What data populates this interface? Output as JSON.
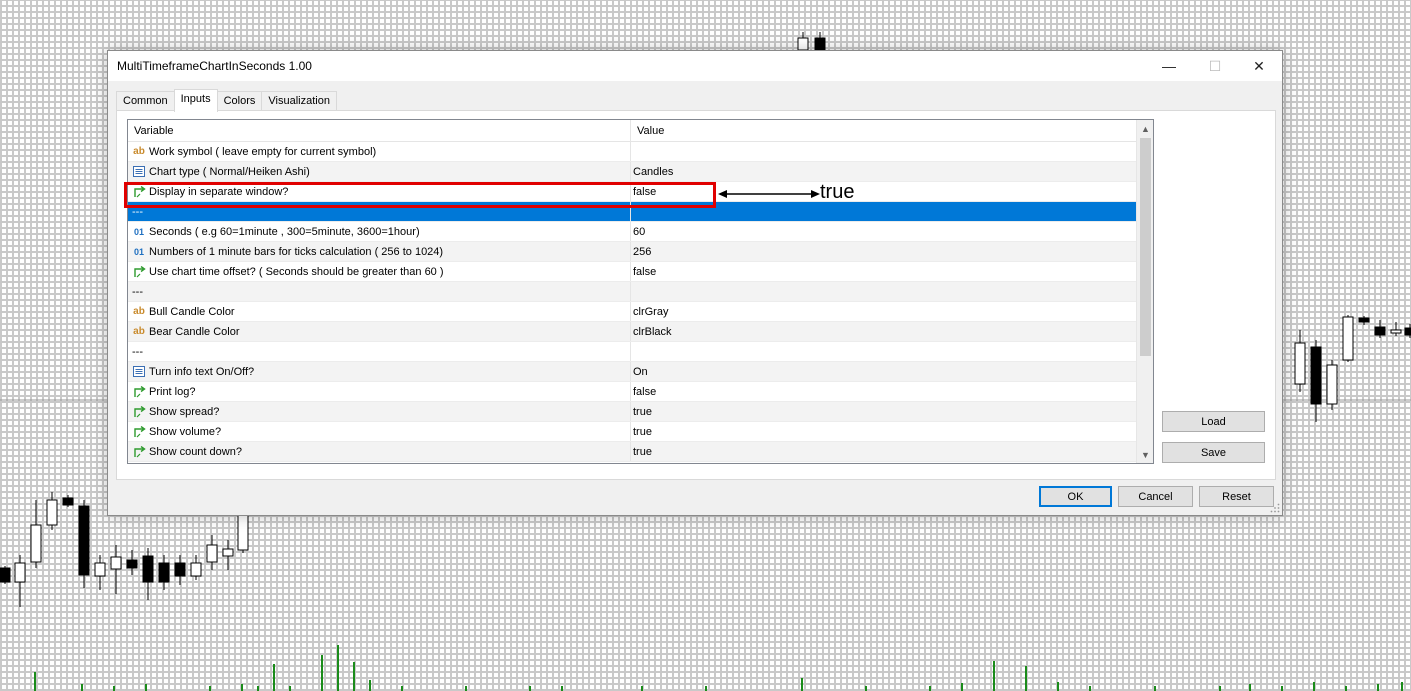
{
  "window": {
    "title": "MultiTimeframeChartInSeconds 1.00",
    "minimize_glyph": "—",
    "maximize_glyph": "☐",
    "close_glyph": "✕"
  },
  "tabs": [
    {
      "label": "Common",
      "active": false
    },
    {
      "label": "Inputs",
      "active": true
    },
    {
      "label": "Colors",
      "active": false
    },
    {
      "label": "Visualization",
      "active": false
    }
  ],
  "table": {
    "headers": {
      "variable": "Variable",
      "value": "Value"
    },
    "rows": [
      {
        "icon": "ab-icon",
        "variable": "Work symbol ( leave empty for current symbol)",
        "value": ""
      },
      {
        "icon": "list-icon",
        "variable": "Chart type ( Normal/Heiken Ashi)",
        "value": "Candles"
      },
      {
        "icon": "bool-arrow-icon",
        "variable": "Display in separate window?",
        "value": "false"
      },
      {
        "icon": "",
        "variable": "---",
        "value": "",
        "selected": true
      },
      {
        "icon": "01-icon",
        "variable": "Seconds ( e.g 60=1minute , 300=5minute, 3600=1hour)",
        "value": "60"
      },
      {
        "icon": "01-icon",
        "variable": "Numbers of 1 minute bars for ticks calculation ( 256 to 1024)",
        "value": "256"
      },
      {
        "icon": "bool-arrow-icon",
        "variable": "Use chart time offset? ( Seconds should be greater than 60 )",
        "value": "false"
      },
      {
        "icon": "",
        "variable": "---",
        "value": ""
      },
      {
        "icon": "ab-icon",
        "variable": "Bull Candle Color",
        "value": "clrGray"
      },
      {
        "icon": "ab-icon",
        "variable": "Bear Candle Color",
        "value": "clrBlack"
      },
      {
        "icon": "",
        "variable": "---",
        "value": ""
      },
      {
        "icon": "list-icon",
        "variable": "Turn info text On/Off?",
        "value": "On"
      },
      {
        "icon": "bool-arrow-icon",
        "variable": "Print log?",
        "value": "false"
      },
      {
        "icon": "bool-arrow-icon",
        "variable": "Show spread?",
        "value": "true"
      },
      {
        "icon": "bool-arrow-icon",
        "variable": "Show volume?",
        "value": "true"
      },
      {
        "icon": "bool-arrow-icon",
        "variable": "Show count down?",
        "value": "true"
      }
    ]
  },
  "side_buttons": {
    "load": "Load",
    "save": "Save"
  },
  "footer_buttons": {
    "ok": "OK",
    "cancel": "Cancel",
    "reset": "Reset"
  },
  "annotation": {
    "text": "true",
    "color": "#e00000"
  },
  "colors": {
    "selection": "#0078d7",
    "volume": "#1a8c1a",
    "bear_candle": "#000000",
    "bull_candle": "#ffffff"
  }
}
